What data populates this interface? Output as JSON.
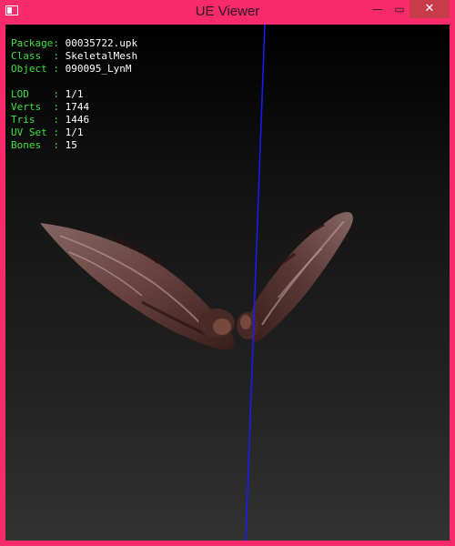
{
  "window": {
    "title": "UE Viewer"
  },
  "controls": {
    "minimize": "—",
    "maximize": "▭",
    "close": "✕"
  },
  "icons": {
    "app": "window-icon",
    "minimize": "minimize-icon",
    "maximize": "maximize-icon",
    "close": "close-icon"
  },
  "info": {
    "package_key": "Package:",
    "package": "00035722.upk",
    "class_key": "Class  :",
    "class": "SkeletalMesh",
    "object_key": "Object :",
    "object": "090095_LynM",
    "lod_key": "LOD    :",
    "lod": "1/1",
    "verts_key": "Verts  :",
    "verts": "1744",
    "tris_key": "Tris   :",
    "tris": "1446",
    "uvset_key": "UV Set :",
    "uvset": "1/1",
    "bones_key": "Bones  :",
    "bones": "15"
  },
  "colors": {
    "frame": "#f72b6c",
    "label": "#40e040",
    "value": "#ffffff",
    "axis": "#1a1aff"
  }
}
